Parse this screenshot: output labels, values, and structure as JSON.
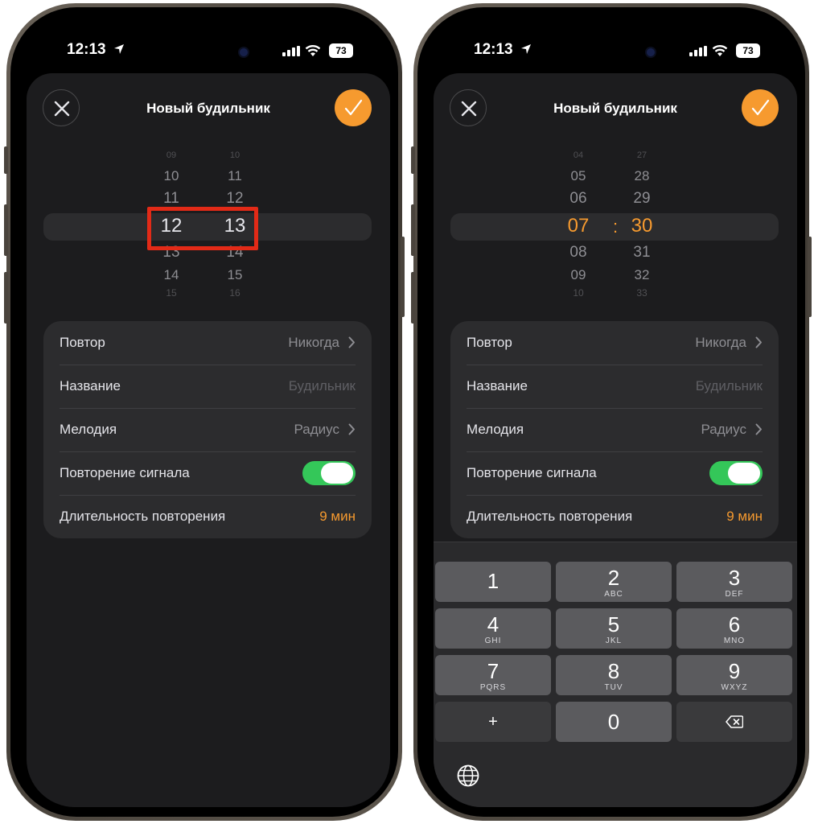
{
  "status_bar": {
    "time": "12:13",
    "battery": "73"
  },
  "left_screen": {
    "title": "Новый будильник",
    "hours": [
      "09",
      "10",
      "11",
      "12",
      "13",
      "14",
      "15"
    ],
    "minutes": [
      "10",
      "11",
      "12",
      "13",
      "14",
      "15",
      "16"
    ],
    "selected_hour": "12",
    "selected_minute": "13",
    "rows": {
      "repeat": {
        "label": "Повтор",
        "value": "Никогда"
      },
      "name": {
        "label": "Название",
        "placeholder": "Будильник"
      },
      "melody": {
        "label": "Мелодия",
        "value": "Радиус"
      },
      "snooze": {
        "label": "Повторение сигнала",
        "enabled": true
      },
      "snooze_duration": {
        "label": "Длительность повторения",
        "value": "9 мин"
      }
    }
  },
  "right_screen": {
    "title": "Новый будильник",
    "hours": [
      "04",
      "05",
      "06",
      "07",
      "08",
      "09",
      "10"
    ],
    "minutes": [
      "27",
      "28",
      "29",
      "30",
      "31",
      "32",
      "33"
    ],
    "selected_hour": "07",
    "selected_minute": "30",
    "separator": ":",
    "rows": {
      "repeat": {
        "label": "Повтор",
        "value": "Никогда"
      },
      "name": {
        "label": "Название",
        "placeholder": "Будильник"
      },
      "melody": {
        "label": "Мелодия",
        "value": "Радиус"
      },
      "snooze": {
        "label": "Повторение сигнала",
        "enabled": true
      },
      "snooze_duration": {
        "label": "Длительность повторения",
        "value": "9 мин"
      }
    },
    "keypad": [
      {
        "num": "1",
        "letters": ""
      },
      {
        "num": "2",
        "letters": "ABC"
      },
      {
        "num": "3",
        "letters": "DEF"
      },
      {
        "num": "4",
        "letters": "GHI"
      },
      {
        "num": "5",
        "letters": "JKL"
      },
      {
        "num": "6",
        "letters": "MNO"
      },
      {
        "num": "7",
        "letters": "PQRS"
      },
      {
        "num": "8",
        "letters": "TUV"
      },
      {
        "num": "9",
        "letters": "WXYZ"
      },
      {
        "num": "+",
        "letters": ""
      },
      {
        "num": "0",
        "letters": ""
      },
      {
        "num": "",
        "letters": ""
      }
    ]
  },
  "icons": {
    "close": "close-icon",
    "confirm": "checkmark-icon",
    "chevron": "chevron-right-icon",
    "location": "location-arrow-icon",
    "signal": "cellular-signal-icon",
    "wifi": "wifi-icon",
    "backspace": "backspace-icon",
    "globe": "globe-icon"
  },
  "colors": {
    "accent": "#f69a2f",
    "toggle_on": "#34c759",
    "annotation": "#e22a17",
    "sheet_bg": "#1c1c1e"
  }
}
